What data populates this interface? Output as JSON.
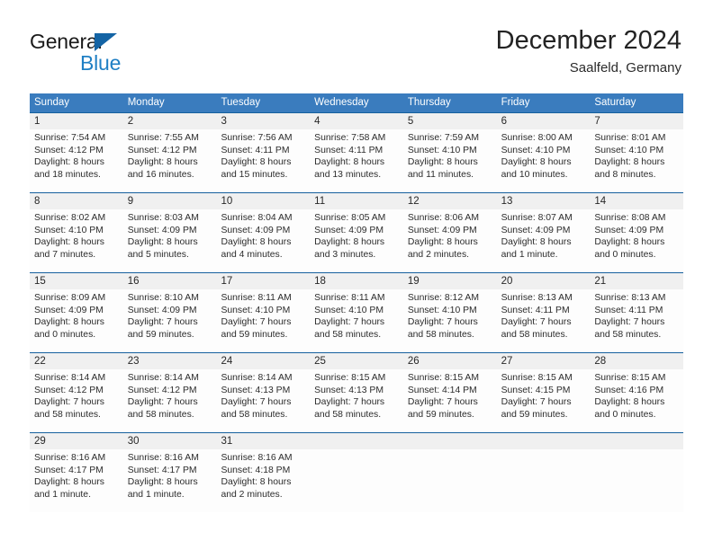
{
  "brand": {
    "name_part1": "General",
    "name_part2": "Blue",
    "triangle_color": "#1464a5",
    "blue_text_color": "#1f7fc4"
  },
  "header": {
    "title": "December 2024",
    "subtitle": "Saalfeld, Germany"
  },
  "colors": {
    "header_row_bg": "#3a7cbe",
    "header_row_text": "#ffffff",
    "row_divider": "#16609e",
    "day_number_bg": "#f0f0f0",
    "cell_bg": "#fdfdfd",
    "body_text": "#2c2c2c"
  },
  "weekdays": [
    "Sunday",
    "Monday",
    "Tuesday",
    "Wednesday",
    "Thursday",
    "Friday",
    "Saturday"
  ],
  "weeks": [
    [
      {
        "day": "1",
        "sunrise": "Sunrise: 7:54 AM",
        "sunset": "Sunset: 4:12 PM",
        "daylight1": "Daylight: 8 hours",
        "daylight2": "and 18 minutes."
      },
      {
        "day": "2",
        "sunrise": "Sunrise: 7:55 AM",
        "sunset": "Sunset: 4:12 PM",
        "daylight1": "Daylight: 8 hours",
        "daylight2": "and 16 minutes."
      },
      {
        "day": "3",
        "sunrise": "Sunrise: 7:56 AM",
        "sunset": "Sunset: 4:11 PM",
        "daylight1": "Daylight: 8 hours",
        "daylight2": "and 15 minutes."
      },
      {
        "day": "4",
        "sunrise": "Sunrise: 7:58 AM",
        "sunset": "Sunset: 4:11 PM",
        "daylight1": "Daylight: 8 hours",
        "daylight2": "and 13 minutes."
      },
      {
        "day": "5",
        "sunrise": "Sunrise: 7:59 AM",
        "sunset": "Sunset: 4:10 PM",
        "daylight1": "Daylight: 8 hours",
        "daylight2": "and 11 minutes."
      },
      {
        "day": "6",
        "sunrise": "Sunrise: 8:00 AM",
        "sunset": "Sunset: 4:10 PM",
        "daylight1": "Daylight: 8 hours",
        "daylight2": "and 10 minutes."
      },
      {
        "day": "7",
        "sunrise": "Sunrise: 8:01 AM",
        "sunset": "Sunset: 4:10 PM",
        "daylight1": "Daylight: 8 hours",
        "daylight2": "and 8 minutes."
      }
    ],
    [
      {
        "day": "8",
        "sunrise": "Sunrise: 8:02 AM",
        "sunset": "Sunset: 4:10 PM",
        "daylight1": "Daylight: 8 hours",
        "daylight2": "and 7 minutes."
      },
      {
        "day": "9",
        "sunrise": "Sunrise: 8:03 AM",
        "sunset": "Sunset: 4:09 PM",
        "daylight1": "Daylight: 8 hours",
        "daylight2": "and 5 minutes."
      },
      {
        "day": "10",
        "sunrise": "Sunrise: 8:04 AM",
        "sunset": "Sunset: 4:09 PM",
        "daylight1": "Daylight: 8 hours",
        "daylight2": "and 4 minutes."
      },
      {
        "day": "11",
        "sunrise": "Sunrise: 8:05 AM",
        "sunset": "Sunset: 4:09 PM",
        "daylight1": "Daylight: 8 hours",
        "daylight2": "and 3 minutes."
      },
      {
        "day": "12",
        "sunrise": "Sunrise: 8:06 AM",
        "sunset": "Sunset: 4:09 PM",
        "daylight1": "Daylight: 8 hours",
        "daylight2": "and 2 minutes."
      },
      {
        "day": "13",
        "sunrise": "Sunrise: 8:07 AM",
        "sunset": "Sunset: 4:09 PM",
        "daylight1": "Daylight: 8 hours",
        "daylight2": "and 1 minute."
      },
      {
        "day": "14",
        "sunrise": "Sunrise: 8:08 AM",
        "sunset": "Sunset: 4:09 PM",
        "daylight1": "Daylight: 8 hours",
        "daylight2": "and 0 minutes."
      }
    ],
    [
      {
        "day": "15",
        "sunrise": "Sunrise: 8:09 AM",
        "sunset": "Sunset: 4:09 PM",
        "daylight1": "Daylight: 8 hours",
        "daylight2": "and 0 minutes."
      },
      {
        "day": "16",
        "sunrise": "Sunrise: 8:10 AM",
        "sunset": "Sunset: 4:09 PM",
        "daylight1": "Daylight: 7 hours",
        "daylight2": "and 59 minutes."
      },
      {
        "day": "17",
        "sunrise": "Sunrise: 8:11 AM",
        "sunset": "Sunset: 4:10 PM",
        "daylight1": "Daylight: 7 hours",
        "daylight2": "and 59 minutes."
      },
      {
        "day": "18",
        "sunrise": "Sunrise: 8:11 AM",
        "sunset": "Sunset: 4:10 PM",
        "daylight1": "Daylight: 7 hours",
        "daylight2": "and 58 minutes."
      },
      {
        "day": "19",
        "sunrise": "Sunrise: 8:12 AM",
        "sunset": "Sunset: 4:10 PM",
        "daylight1": "Daylight: 7 hours",
        "daylight2": "and 58 minutes."
      },
      {
        "day": "20",
        "sunrise": "Sunrise: 8:13 AM",
        "sunset": "Sunset: 4:11 PM",
        "daylight1": "Daylight: 7 hours",
        "daylight2": "and 58 minutes."
      },
      {
        "day": "21",
        "sunrise": "Sunrise: 8:13 AM",
        "sunset": "Sunset: 4:11 PM",
        "daylight1": "Daylight: 7 hours",
        "daylight2": "and 58 minutes."
      }
    ],
    [
      {
        "day": "22",
        "sunrise": "Sunrise: 8:14 AM",
        "sunset": "Sunset: 4:12 PM",
        "daylight1": "Daylight: 7 hours",
        "daylight2": "and 58 minutes."
      },
      {
        "day": "23",
        "sunrise": "Sunrise: 8:14 AM",
        "sunset": "Sunset: 4:12 PM",
        "daylight1": "Daylight: 7 hours",
        "daylight2": "and 58 minutes."
      },
      {
        "day": "24",
        "sunrise": "Sunrise: 8:14 AM",
        "sunset": "Sunset: 4:13 PM",
        "daylight1": "Daylight: 7 hours",
        "daylight2": "and 58 minutes."
      },
      {
        "day": "25",
        "sunrise": "Sunrise: 8:15 AM",
        "sunset": "Sunset: 4:13 PM",
        "daylight1": "Daylight: 7 hours",
        "daylight2": "and 58 minutes."
      },
      {
        "day": "26",
        "sunrise": "Sunrise: 8:15 AM",
        "sunset": "Sunset: 4:14 PM",
        "daylight1": "Daylight: 7 hours",
        "daylight2": "and 59 minutes."
      },
      {
        "day": "27",
        "sunrise": "Sunrise: 8:15 AM",
        "sunset": "Sunset: 4:15 PM",
        "daylight1": "Daylight: 7 hours",
        "daylight2": "and 59 minutes."
      },
      {
        "day": "28",
        "sunrise": "Sunrise: 8:15 AM",
        "sunset": "Sunset: 4:16 PM",
        "daylight1": "Daylight: 8 hours",
        "daylight2": "and 0 minutes."
      }
    ],
    [
      {
        "day": "29",
        "sunrise": "Sunrise: 8:16 AM",
        "sunset": "Sunset: 4:17 PM",
        "daylight1": "Daylight: 8 hours",
        "daylight2": "and 1 minute."
      },
      {
        "day": "30",
        "sunrise": "Sunrise: 8:16 AM",
        "sunset": "Sunset: 4:17 PM",
        "daylight1": "Daylight: 8 hours",
        "daylight2": "and 1 minute."
      },
      {
        "day": "31",
        "sunrise": "Sunrise: 8:16 AM",
        "sunset": "Sunset: 4:18 PM",
        "daylight1": "Daylight: 8 hours",
        "daylight2": "and 2 minutes."
      },
      {
        "day": "",
        "sunrise": "",
        "sunset": "",
        "daylight1": "",
        "daylight2": ""
      },
      {
        "day": "",
        "sunrise": "",
        "sunset": "",
        "daylight1": "",
        "daylight2": ""
      },
      {
        "day": "",
        "sunrise": "",
        "sunset": "",
        "daylight1": "",
        "daylight2": ""
      },
      {
        "day": "",
        "sunrise": "",
        "sunset": "",
        "daylight1": "",
        "daylight2": ""
      }
    ]
  ]
}
